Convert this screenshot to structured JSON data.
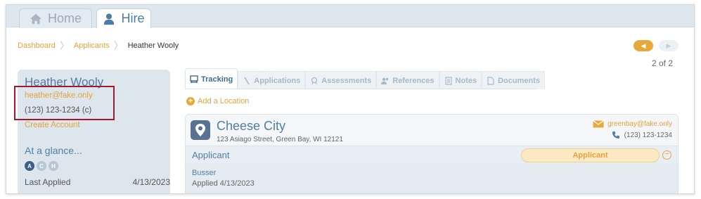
{
  "top_tabs": {
    "home_label": "Home",
    "hire_label": "Hire"
  },
  "breadcrumb": {
    "items": [
      "Dashboard",
      "Applicants"
    ],
    "current": "Heather Wooly"
  },
  "pager": {
    "count": "2 of 2",
    "prev_glyph": "◀",
    "next_glyph": "▶"
  },
  "sidebar": {
    "name": "Heather Wooly",
    "email": "heather@fake.only",
    "phone": "(123) 123-1234 (c)",
    "create_account": "Create Account",
    "glance_title": "At a glance...",
    "glance_circles": [
      "A",
      "C",
      "H"
    ],
    "last_applied_label": "Last Applied",
    "last_applied_date": "4/13/2023"
  },
  "content_tabs": [
    "Tracking",
    "Applications",
    "Assessments",
    "References",
    "Notes",
    "Documents"
  ],
  "add_location": "Add a Location",
  "location": {
    "name": "Cheese City",
    "address": "123 Asiago Street, Green Bay, WI 12121",
    "email": "greenbay@fake.only",
    "phone": "(123) 123-1234",
    "section_label": "Applicant",
    "status": "Applicant",
    "job_title": "Busser",
    "applied": "Applied 4/13/2023"
  },
  "colors": {
    "accent_orange": "#e5a23b",
    "primary_blue": "#4f7ea6",
    "highlight_red": "#a3172f"
  }
}
